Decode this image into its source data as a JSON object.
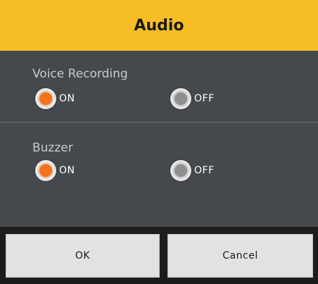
{
  "dialog": {
    "title": "Audio",
    "sections": [
      {
        "label": "Voice Recording",
        "options": [
          {
            "label": "ON",
            "selected": true
          },
          {
            "label": "OFF",
            "selected": false
          }
        ]
      },
      {
        "label": "Buzzer",
        "options": [
          {
            "label": "ON",
            "selected": true
          },
          {
            "label": "OFF",
            "selected": false
          }
        ]
      }
    ],
    "buttons": {
      "ok_label": "OK",
      "cancel_label": "Cancel"
    }
  },
  "colors": {
    "title_bar": "#f6bd24",
    "background": "#45494d",
    "selected_radio": "#f4731c",
    "unselected_radio": "#8f8f8f"
  }
}
